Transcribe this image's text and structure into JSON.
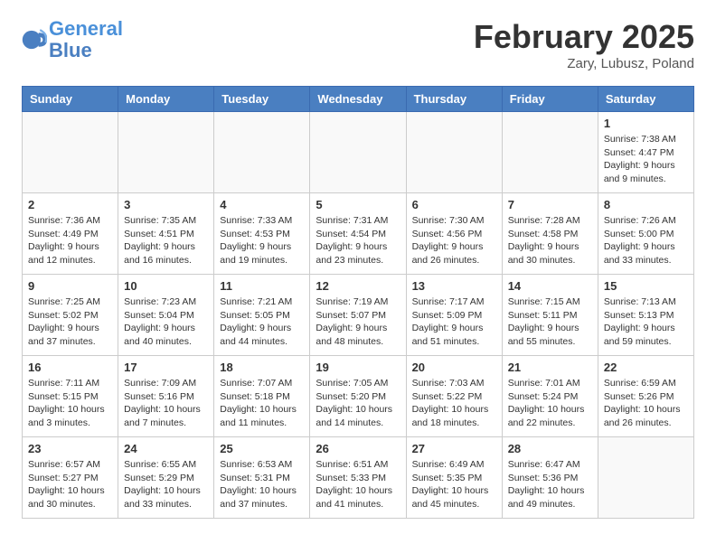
{
  "logo": {
    "line1": "General",
    "line2": "Blue"
  },
  "title": "February 2025",
  "subtitle": "Zary, Lubusz, Poland",
  "headers": [
    "Sunday",
    "Monday",
    "Tuesday",
    "Wednesday",
    "Thursday",
    "Friday",
    "Saturday"
  ],
  "weeks": [
    [
      {
        "day": "",
        "info": ""
      },
      {
        "day": "",
        "info": ""
      },
      {
        "day": "",
        "info": ""
      },
      {
        "day": "",
        "info": ""
      },
      {
        "day": "",
        "info": ""
      },
      {
        "day": "",
        "info": ""
      },
      {
        "day": "1",
        "info": "Sunrise: 7:38 AM\nSunset: 4:47 PM\nDaylight: 9 hours and 9 minutes."
      }
    ],
    [
      {
        "day": "2",
        "info": "Sunrise: 7:36 AM\nSunset: 4:49 PM\nDaylight: 9 hours and 12 minutes."
      },
      {
        "day": "3",
        "info": "Sunrise: 7:35 AM\nSunset: 4:51 PM\nDaylight: 9 hours and 16 minutes."
      },
      {
        "day": "4",
        "info": "Sunrise: 7:33 AM\nSunset: 4:53 PM\nDaylight: 9 hours and 19 minutes."
      },
      {
        "day": "5",
        "info": "Sunrise: 7:31 AM\nSunset: 4:54 PM\nDaylight: 9 hours and 23 minutes."
      },
      {
        "day": "6",
        "info": "Sunrise: 7:30 AM\nSunset: 4:56 PM\nDaylight: 9 hours and 26 minutes."
      },
      {
        "day": "7",
        "info": "Sunrise: 7:28 AM\nSunset: 4:58 PM\nDaylight: 9 hours and 30 minutes."
      },
      {
        "day": "8",
        "info": "Sunrise: 7:26 AM\nSunset: 5:00 PM\nDaylight: 9 hours and 33 minutes."
      }
    ],
    [
      {
        "day": "9",
        "info": "Sunrise: 7:25 AM\nSunset: 5:02 PM\nDaylight: 9 hours and 37 minutes."
      },
      {
        "day": "10",
        "info": "Sunrise: 7:23 AM\nSunset: 5:04 PM\nDaylight: 9 hours and 40 minutes."
      },
      {
        "day": "11",
        "info": "Sunrise: 7:21 AM\nSunset: 5:05 PM\nDaylight: 9 hours and 44 minutes."
      },
      {
        "day": "12",
        "info": "Sunrise: 7:19 AM\nSunset: 5:07 PM\nDaylight: 9 hours and 48 minutes."
      },
      {
        "day": "13",
        "info": "Sunrise: 7:17 AM\nSunset: 5:09 PM\nDaylight: 9 hours and 51 minutes."
      },
      {
        "day": "14",
        "info": "Sunrise: 7:15 AM\nSunset: 5:11 PM\nDaylight: 9 hours and 55 minutes."
      },
      {
        "day": "15",
        "info": "Sunrise: 7:13 AM\nSunset: 5:13 PM\nDaylight: 9 hours and 59 minutes."
      }
    ],
    [
      {
        "day": "16",
        "info": "Sunrise: 7:11 AM\nSunset: 5:15 PM\nDaylight: 10 hours and 3 minutes."
      },
      {
        "day": "17",
        "info": "Sunrise: 7:09 AM\nSunset: 5:16 PM\nDaylight: 10 hours and 7 minutes."
      },
      {
        "day": "18",
        "info": "Sunrise: 7:07 AM\nSunset: 5:18 PM\nDaylight: 10 hours and 11 minutes."
      },
      {
        "day": "19",
        "info": "Sunrise: 7:05 AM\nSunset: 5:20 PM\nDaylight: 10 hours and 14 minutes."
      },
      {
        "day": "20",
        "info": "Sunrise: 7:03 AM\nSunset: 5:22 PM\nDaylight: 10 hours and 18 minutes."
      },
      {
        "day": "21",
        "info": "Sunrise: 7:01 AM\nSunset: 5:24 PM\nDaylight: 10 hours and 22 minutes."
      },
      {
        "day": "22",
        "info": "Sunrise: 6:59 AM\nSunset: 5:26 PM\nDaylight: 10 hours and 26 minutes."
      }
    ],
    [
      {
        "day": "23",
        "info": "Sunrise: 6:57 AM\nSunset: 5:27 PM\nDaylight: 10 hours and 30 minutes."
      },
      {
        "day": "24",
        "info": "Sunrise: 6:55 AM\nSunset: 5:29 PM\nDaylight: 10 hours and 33 minutes."
      },
      {
        "day": "25",
        "info": "Sunrise: 6:53 AM\nSunset: 5:31 PM\nDaylight: 10 hours and 37 minutes."
      },
      {
        "day": "26",
        "info": "Sunrise: 6:51 AM\nSunset: 5:33 PM\nDaylight: 10 hours and 41 minutes."
      },
      {
        "day": "27",
        "info": "Sunrise: 6:49 AM\nSunset: 5:35 PM\nDaylight: 10 hours and 45 minutes."
      },
      {
        "day": "28",
        "info": "Sunrise: 6:47 AM\nSunset: 5:36 PM\nDaylight: 10 hours and 49 minutes."
      },
      {
        "day": "",
        "info": ""
      }
    ]
  ]
}
